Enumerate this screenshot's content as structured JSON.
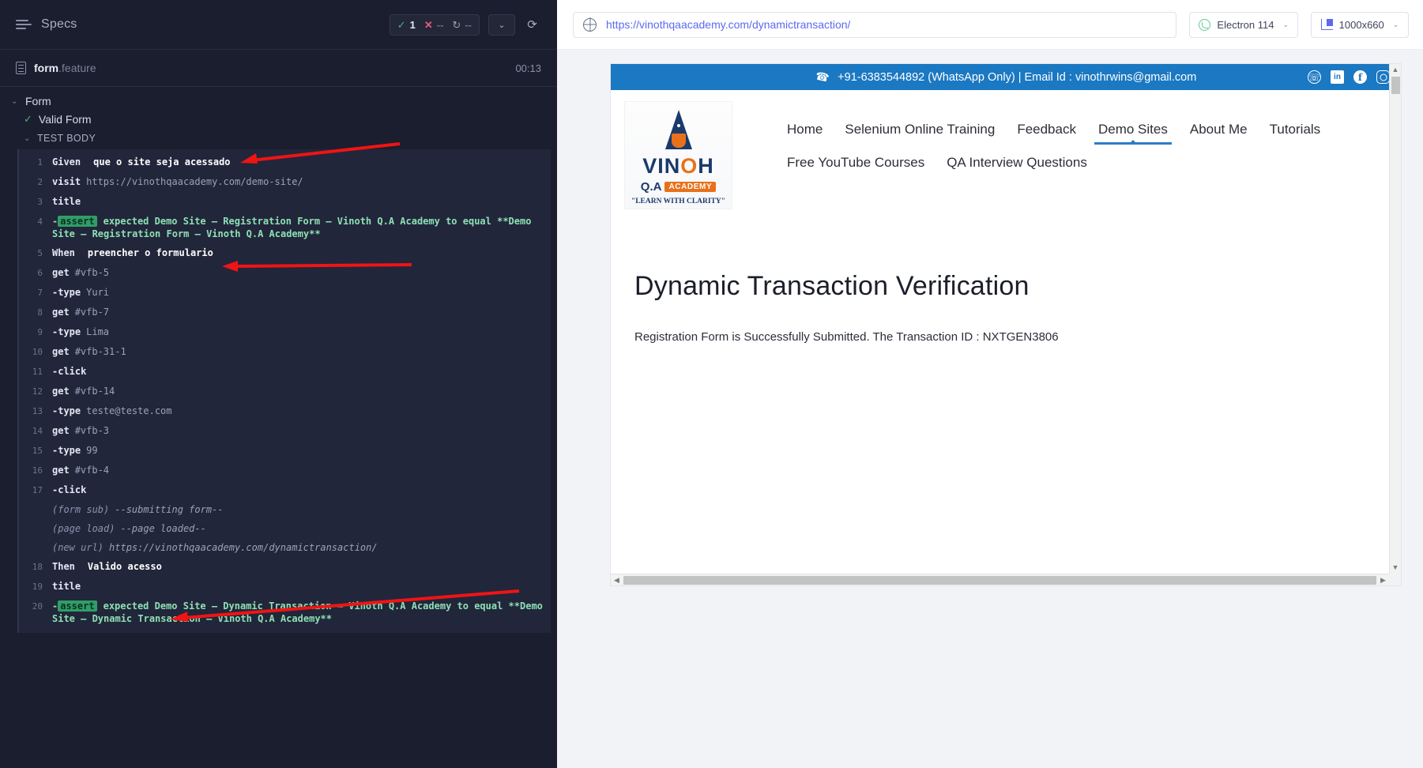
{
  "reporter": {
    "specs_label": "Specs",
    "specs_icon": "list-icon",
    "stats": {
      "passed_glyph": "✓",
      "passed_count": "1",
      "failed_glyph": "✕",
      "failed_count": "--",
      "pending_glyph": "↻",
      "pending_count": "--"
    },
    "buttons": {
      "chevron": "⌄",
      "restart": "⟳"
    },
    "spec_file": {
      "name": "form",
      "ext": ".feature",
      "time": "00:13"
    },
    "suite": {
      "chevron": "⌄",
      "title": "Form"
    },
    "test": {
      "tick": "✓",
      "title": "Valid Form"
    },
    "test_body_label": "TEST BODY",
    "commands": [
      {
        "num": "1",
        "type": "gherkin",
        "method": "Given",
        "arg": "que o site seja acessado"
      },
      {
        "num": "2",
        "type": "cmd",
        "method": "visit",
        "arg": "https://vinothqaacademy.com/demo-site/"
      },
      {
        "num": "3",
        "type": "cmd",
        "method": "title",
        "arg": ""
      },
      {
        "num": "4",
        "type": "assert",
        "method": "assert",
        "arg": "expected Demo Site – Registration Form – Vinoth Q.A Academy to equal **Demo Site – Registration Form – Vinoth Q.A Academy**"
      },
      {
        "num": "5",
        "type": "gherkin",
        "method": "When",
        "arg": "preencher o formulario"
      },
      {
        "num": "6",
        "type": "cmd",
        "method": "get",
        "arg": "#vfb-5"
      },
      {
        "num": "7",
        "type": "child",
        "method": "-type",
        "arg": "Yuri"
      },
      {
        "num": "8",
        "type": "cmd",
        "method": "get",
        "arg": "#vfb-7"
      },
      {
        "num": "9",
        "type": "child",
        "method": "-type",
        "arg": "Lima"
      },
      {
        "num": "10",
        "type": "cmd",
        "method": "get",
        "arg": "#vfb-31-1"
      },
      {
        "num": "11",
        "type": "child",
        "method": "-click",
        "arg": ""
      },
      {
        "num": "12",
        "type": "cmd",
        "method": "get",
        "arg": "#vfb-14"
      },
      {
        "num": "13",
        "type": "child",
        "method": "-type",
        "arg": "teste@teste.com"
      },
      {
        "num": "14",
        "type": "cmd",
        "method": "get",
        "arg": "#vfb-3"
      },
      {
        "num": "15",
        "type": "child",
        "method": "-type",
        "arg": "99"
      },
      {
        "num": "16",
        "type": "cmd",
        "method": "get",
        "arg": "#vfb-4"
      },
      {
        "num": "17",
        "type": "child",
        "method": "-click",
        "arg": ""
      },
      {
        "num": "",
        "type": "event",
        "method": "(form sub)",
        "arg": "--submitting form--"
      },
      {
        "num": "",
        "type": "event",
        "method": "(page load)",
        "arg": "--page loaded--"
      },
      {
        "num": "",
        "type": "event",
        "method": "(new url)",
        "arg": "https://vinothqaacademy.com/dynamictransaction/"
      },
      {
        "num": "18",
        "type": "gherkin",
        "method": "Then",
        "arg": "Valido acesso"
      },
      {
        "num": "19",
        "type": "cmd",
        "method": "title",
        "arg": ""
      },
      {
        "num": "20",
        "type": "assert",
        "method": "assert",
        "arg": "expected Demo Site – Dynamic Transaction – Vinoth Q.A Academy to equal **Demo Site – Dynamic Transaction – Vinoth Q.A Academy**"
      }
    ]
  },
  "browser": {
    "globe_icon": "globe-icon",
    "url": "https://vinothqaacademy.com/dynamictransaction/",
    "browser_select": "Electron 114",
    "viewport_select": "1000x660",
    "caret": "⌄"
  },
  "site": {
    "contact_bar": {
      "phone_icon": "phone-icon",
      "text": "+91-6383544892 (WhatsApp Only) | Email Id : vinothrwins@gmail.com",
      "socials": [
        {
          "name": "whatsapp-icon",
          "glyph": "✆"
        },
        {
          "name": "linkedin-icon",
          "glyph": "in"
        },
        {
          "name": "facebook-icon",
          "glyph": "f"
        },
        {
          "name": "instagram-icon",
          "glyph": ""
        }
      ]
    },
    "logo": {
      "name_part1": "VIN",
      "name_o": "O",
      "name_part2": "H",
      "qa": "Q.A",
      "academy": "ACADEMY",
      "tagline": "\"LEARN WITH CLARITY\""
    },
    "nav": {
      "row1": [
        "Home",
        "Selenium Online Training",
        "Feedback",
        "Demo Sites",
        "About Me",
        "Tutorials"
      ],
      "row2": [
        "Free YouTube Courses",
        "QA Interview Questions"
      ],
      "active": "Demo Sites"
    },
    "page": {
      "title": "Dynamic Transaction Verification",
      "paragraph": "Registration Form is Successfully Submitted. The Transaction ID : NXTGEN3806"
    },
    "scrollbar": {
      "up": "▲",
      "down": "▼",
      "left": "◀",
      "right": "▶"
    }
  },
  "annotations": {
    "color": "#f01414"
  }
}
